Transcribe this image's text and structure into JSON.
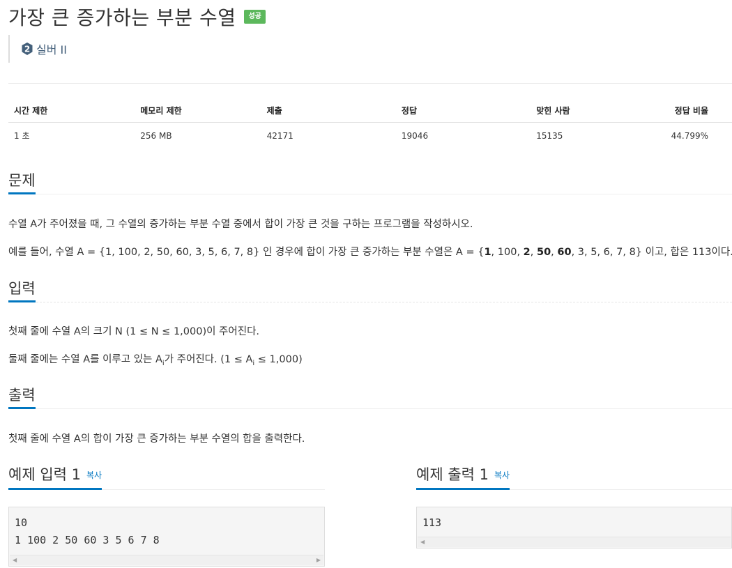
{
  "problem": {
    "title": "가장 큰 증가하는 부분 수열",
    "status_badge": "성공",
    "tier": {
      "icon": "silver-tier-icon",
      "number": "2",
      "label": "실버 II"
    }
  },
  "info_table": {
    "headers": [
      "시간 제한",
      "메모리 제한",
      "제출",
      "정답",
      "맞힌 사람",
      "정답 비율"
    ],
    "values": [
      "1 초",
      "256 MB",
      "42171",
      "19046",
      "15135",
      "44.799%"
    ]
  },
  "sections": {
    "problem": {
      "title": "문제",
      "p1": "수열 A가 주어졌을 때, 그 수열의 증가하는 부분 수열 중에서 합이 가장 큰 것을 구하는 프로그램을 작성하시오.",
      "p2_a": "예를 들어, 수열 A = {1, 100, 2, 50, 60, 3, 5, 6, 7, 8} 인 경우에 합이 가장 큰 증가하는 부분 수열은 A = {",
      "p2_b1": "1",
      "p2_c1": ", 100, ",
      "p2_b2": "2",
      "p2_c2": ", ",
      "p2_b3": "50",
      "p2_c3": ", ",
      "p2_b4": "60",
      "p2_d": ", 3, 5, 6, 7, 8} 이고, 합은 113이다."
    },
    "input": {
      "title": "입력",
      "p1": "첫째 줄에 수열 A의 크기 N (1 ≤ N ≤ 1,000)이 주어진다.",
      "p2_a": "둘째 줄에는 수열 A를 이루고 있는 A",
      "p2_sub1": "i",
      "p2_b": "가 주어진다. (1 ≤ A",
      "p2_sub2": "i",
      "p2_c": " ≤ 1,000)"
    },
    "output": {
      "title": "출력",
      "p1": "첫째 줄에 수열 A의 합이 가장 큰 증가하는 부분 수열의 합을 출력한다."
    }
  },
  "samples": {
    "input": {
      "title": "예제 입력 1",
      "copy": "복사",
      "content": "10\n1 100 2 50 60 3 5 6 7 8"
    },
    "output": {
      "title": "예제 출력 1",
      "copy": "복사",
      "content": "113"
    }
  },
  "colors": {
    "accent": "#0076c0",
    "success": "#5cb85c",
    "tier_silver": "#435f7a"
  }
}
